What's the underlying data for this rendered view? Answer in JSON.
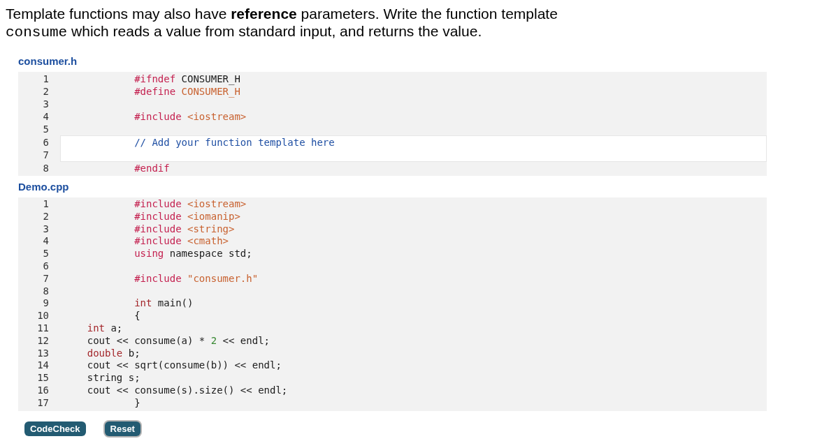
{
  "prompt": [
    {
      "kind": "text",
      "text": "Template functions may also have **reference** parameters. Write the function template"
    },
    {
      "kind": "code",
      "text": "consume"
    },
    {
      "kind": "text",
      "text": "which reads a value from standard input, and returns the value."
    }
  ],
  "files": [
    {
      "name": "consumer.h",
      "sections": [
        {
          "editable": false,
          "lines": [
            {
              "number": "1",
              "tokens": [
                {
                  "kind": "keyword",
                  "text": "#ifndef"
                },
                {
                  "kind": "plain",
                  "text": " CONSUMER_H"
                }
              ]
            },
            {
              "number": "2",
              "tokens": [
                {
                  "kind": "keyword",
                  "text": "#define"
                },
                {
                  "kind": "string",
                  "text": " CONSUMER_H"
                }
              ]
            },
            {
              "number": "3"
            },
            {
              "number": "4",
              "tokens": [
                {
                  "kind": "keyword",
                  "text": "#include"
                },
                {
                  "kind": "string",
                  "text": " <iostream>"
                }
              ]
            },
            {
              "number": "5"
            }
          ]
        },
        {
          "editable": true,
          "lines": [
            {
              "number": "6",
              "tokens": [
                {
                  "kind": "comment",
                  "text": "// Add your function template here"
                }
              ]
            },
            {
              "number": "7"
            }
          ]
        },
        {
          "editable": false,
          "lines": [
            {
              "number": "8",
              "tokens": [
                {
                  "kind": "keyword",
                  "text": "#endif"
                }
              ]
            }
          ]
        }
      ]
    },
    {
      "name": "Demo.cpp",
      "sections": [
        {
          "editable": false,
          "lines": [
            {
              "number": "1",
              "tokens": [
                {
                  "kind": "keyword",
                  "text": "#include"
                },
                {
                  "kind": "string",
                  "text": " <iostream>"
                }
              ]
            },
            {
              "number": "2",
              "tokens": [
                {
                  "kind": "keyword",
                  "text": "#include"
                },
                {
                  "kind": "string",
                  "text": " <iomanip>"
                }
              ]
            },
            {
              "number": "3",
              "tokens": [
                {
                  "kind": "keyword",
                  "text": "#include"
                },
                {
                  "kind": "string",
                  "text": " <string>"
                }
              ]
            },
            {
              "number": "4",
              "tokens": [
                {
                  "kind": "keyword",
                  "text": "#include"
                },
                {
                  "kind": "string",
                  "text": " <cmath>"
                }
              ]
            },
            {
              "number": "5",
              "tokens": [
                {
                  "kind": "keyword",
                  "text": "using"
                },
                {
                  "kind": "plain",
                  "text": " namespace std;"
                }
              ]
            },
            {
              "number": "6"
            },
            {
              "number": "7",
              "tokens": [
                {
                  "kind": "keyword",
                  "text": "#include"
                },
                {
                  "kind": "string",
                  "text": " \"consumer.h\""
                }
              ]
            },
            {
              "number": "8"
            },
            {
              "number": "9",
              "tokens": [
                {
                  "kind": "type",
                  "text": "int"
                },
                {
                  "kind": "plain",
                  "text": " main()"
                }
              ]
            },
            {
              "number": "10",
              "tokens": [
                {
                  "kind": "plain",
                  "text": "{"
                }
              ],
              "children": [
                {
                  "number": "11",
                  "tokens": [
                    {
                      "kind": "type",
                      "text": "int"
                    },
                    {
                      "kind": "plain",
                      "text": " a;"
                    }
                  ]
                },
                {
                  "number": "12",
                  "tokens": [
                    {
                      "kind": "plain",
                      "text": "cout << consume(a) * "
                    },
                    {
                      "kind": "number",
                      "text": "2"
                    },
                    {
                      "kind": "plain",
                      "text": " << endl;"
                    }
                  ]
                },
                {
                  "number": "13",
                  "tokens": [
                    {
                      "kind": "type",
                      "text": "double"
                    },
                    {
                      "kind": "plain",
                      "text": " b;"
                    }
                  ]
                },
                {
                  "number": "14",
                  "tokens": [
                    {
                      "kind": "plain",
                      "text": "cout << sqrt(consume(b)) << endl;"
                    }
                  ]
                },
                {
                  "number": "15",
                  "tokens": [
                    {
                      "kind": "plain",
                      "text": "string s;"
                    }
                  ]
                },
                {
                  "number": "16",
                  "tokens": [
                    {
                      "kind": "plain",
                      "text": "cout << consume(s).size() << endl;"
                    }
                  ]
                }
              ]
            },
            {
              "number": "17",
              "tokens": [
                {
                  "kind": "plain",
                  "text": "}"
                }
              ]
            }
          ]
        }
      ]
    }
  ],
  "buttons": [
    {
      "label": "CodeCheck",
      "focused": false
    },
    {
      "label": "Reset",
      "focused": true
    }
  ]
}
